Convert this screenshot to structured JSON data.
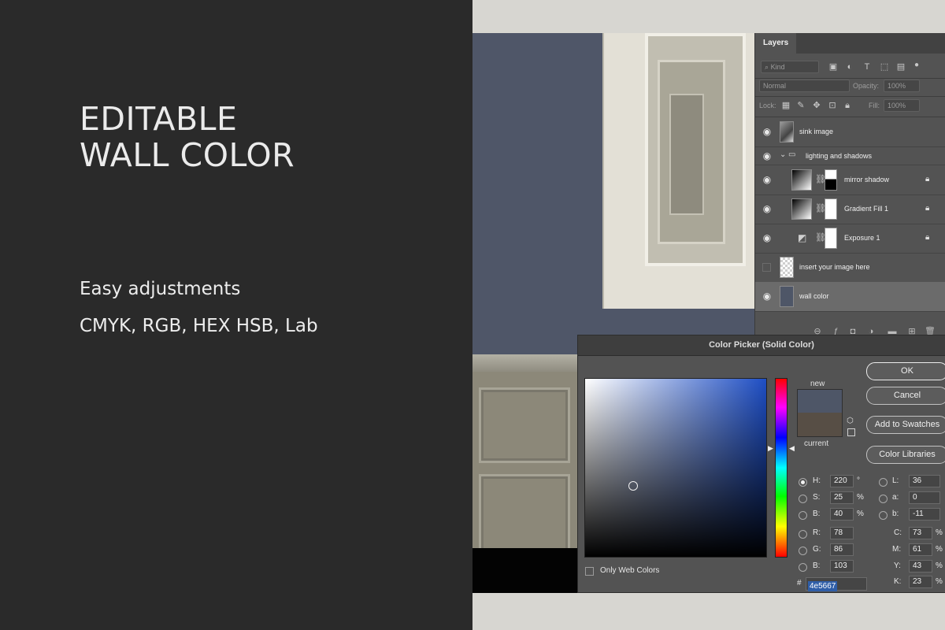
{
  "promo": {
    "headline_line1": "EDITABLE",
    "headline_line2": "WALL COLOR",
    "subtitle1": "Easy adjustments",
    "subtitle2": "CMYK, RGB, HEX HSB, Lab"
  },
  "layers_panel": {
    "tab_label": "Layers",
    "filter_kind": "Kind",
    "blend_mode": "Normal",
    "opacity_label": "Opacity:",
    "opacity_value": "100%",
    "lock_label": "Lock:",
    "fill_label": "Fill:",
    "fill_value": "100%",
    "layers": [
      {
        "name": "sink image"
      },
      {
        "name": "lighting and shadows"
      },
      {
        "name": "mirror shadow"
      },
      {
        "name": "Gradient Fill 1"
      },
      {
        "name": "Exposure 1"
      },
      {
        "name": "insert your image here"
      },
      {
        "name": "wall color"
      }
    ]
  },
  "color_picker": {
    "title": "Color Picker (Solid Color)",
    "new_label": "new",
    "current_label": "current",
    "new_color": "#4e5667",
    "current_color": "#574e45",
    "buttons": {
      "ok": "OK",
      "cancel": "Cancel",
      "add_to_swatches": "Add to Swatches",
      "color_libraries": "Color Libraries"
    },
    "only_web_colors": "Only Web Colors",
    "fields": {
      "H": {
        "label": "H:",
        "value": "220",
        "unit": "°"
      },
      "S": {
        "label": "S:",
        "value": "25",
        "unit": "%"
      },
      "Bv": {
        "label": "B:",
        "value": "40",
        "unit": "%"
      },
      "R": {
        "label": "R:",
        "value": "78"
      },
      "G": {
        "label": "G:",
        "value": "86"
      },
      "B": {
        "label": "B:",
        "value": "103"
      },
      "L": {
        "label": "L:",
        "value": "36"
      },
      "a": {
        "label": "a:",
        "value": "0"
      },
      "b": {
        "label": "b:",
        "value": "-11"
      },
      "C": {
        "label": "C:",
        "value": "73",
        "unit": "%"
      },
      "M": {
        "label": "M:",
        "value": "61",
        "unit": "%"
      },
      "Y": {
        "label": "Y:",
        "value": "43",
        "unit": "%"
      },
      "K": {
        "label": "K:",
        "value": "23",
        "unit": "%"
      }
    },
    "hex_label": "#",
    "hex_value": "4e5667"
  }
}
